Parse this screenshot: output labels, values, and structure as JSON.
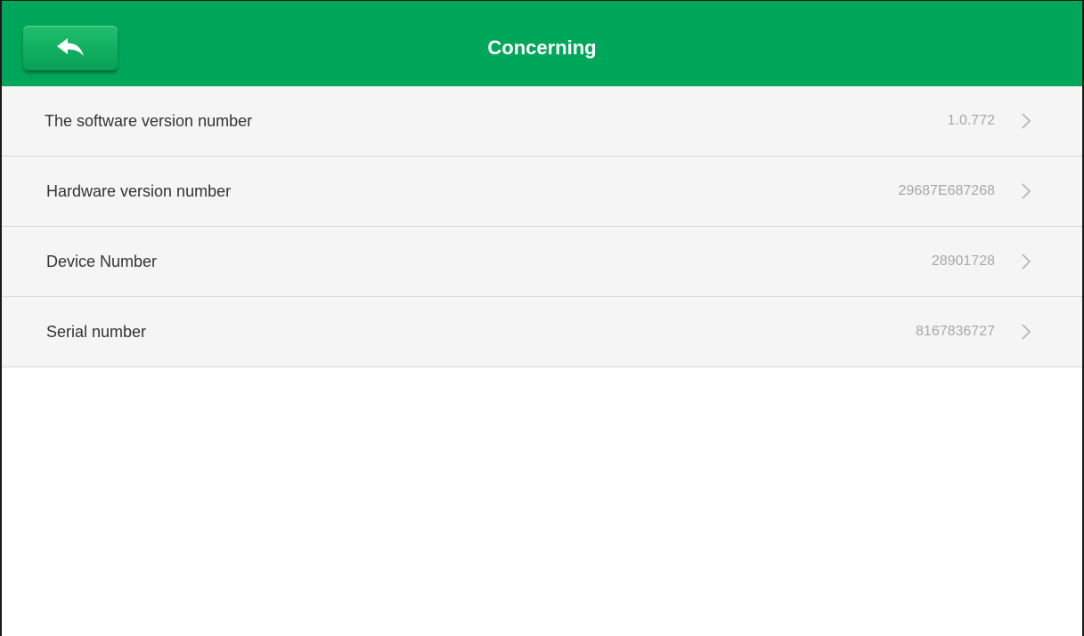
{
  "header": {
    "title": "Concerning",
    "back_icon": "reply-arrow-icon",
    "color": "#00a65a"
  },
  "rows": [
    {
      "label": "The software version number",
      "value": "1.0.772",
      "icon": "chevron-right-icon"
    },
    {
      "label": "Hardware version number",
      "value": "29687E687268",
      "icon": "chevron-right-icon"
    },
    {
      "label": "Device Number",
      "value": "28901728",
      "icon": "chevron-right-icon"
    },
    {
      "label": "Serial number",
      "value": "8167836727",
      "icon": "chevron-right-icon"
    }
  ]
}
